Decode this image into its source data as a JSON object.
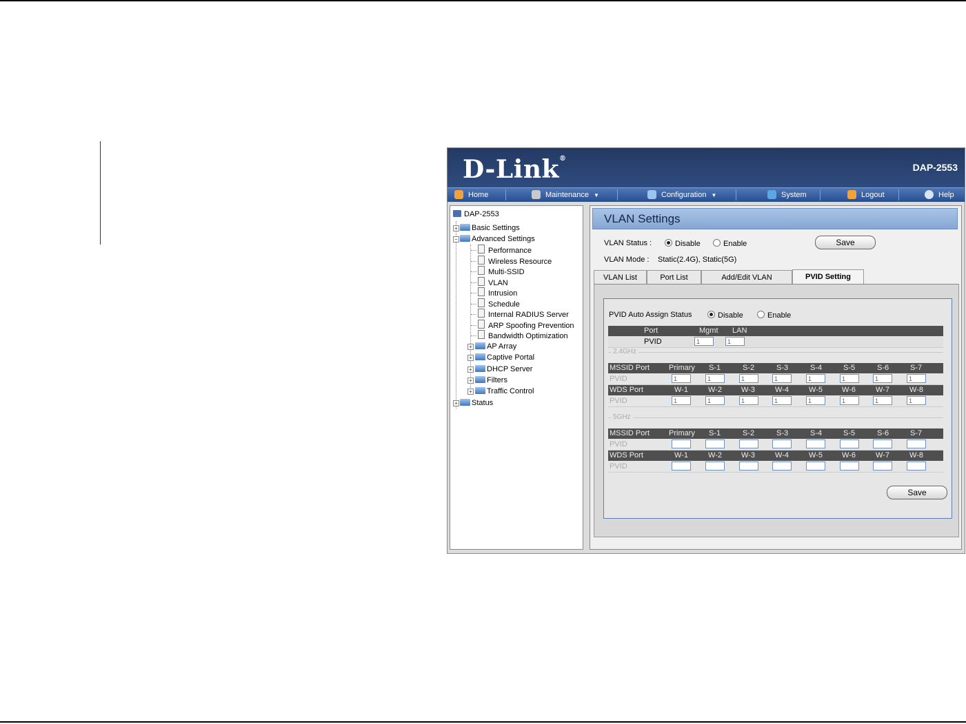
{
  "brand": {
    "logo": "D-Link",
    "model": "DAP-2553"
  },
  "menu": [
    {
      "label": "Home",
      "dropdown": false
    },
    {
      "label": "Maintenance",
      "dropdown": true
    },
    {
      "label": "Configuration",
      "dropdown": true
    },
    {
      "label": "System",
      "dropdown": false
    },
    {
      "label": "Logout",
      "dropdown": false
    },
    {
      "label": "Help",
      "dropdown": false
    }
  ],
  "tree": {
    "root": "DAP-2553",
    "items": [
      {
        "label": "Basic Settings"
      },
      {
        "label": "Advanced Settings"
      },
      {
        "label": "Performance"
      },
      {
        "label": "Wireless Resource"
      },
      {
        "label": "Multi-SSID"
      },
      {
        "label": "VLAN"
      },
      {
        "label": "Intrusion"
      },
      {
        "label": "Schedule"
      },
      {
        "label": "Internal RADIUS Server"
      },
      {
        "label": "ARP Spoofing Prevention"
      },
      {
        "label": "Bandwidth Optimization"
      },
      {
        "label": "AP Array"
      },
      {
        "label": "Captive Portal"
      },
      {
        "label": "DHCP Server"
      },
      {
        "label": "Filters"
      },
      {
        "label": "Traffic Control"
      },
      {
        "label": "Status"
      }
    ]
  },
  "page": {
    "title": "VLAN Settings",
    "vlan_status_label": "VLAN Status :",
    "disable": "Disable",
    "enable": "Enable",
    "save": "Save",
    "vlan_mode_label": "VLAN Mode :",
    "vlan_mode_value": "Static(2.4G),  Static(5G)",
    "tabs": [
      "VLAN List",
      "Port List",
      "Add/Edit VLAN",
      "PVID Setting"
    ],
    "active_tab": "PVID Setting",
    "pvid_auto_label": "PVID Auto Assign Status",
    "port_label": "Port",
    "pvid_label": "PVID",
    "mgmt": "Mgmt",
    "lan": "LAN",
    "mgmt_value": "1",
    "lan_value": "1",
    "band_24": "2.4GHz",
    "band_5": "5GHz",
    "mssid_port": "MSSID Port",
    "wds_port": "WDS Port",
    "mssid_cols": [
      "Primary",
      "S-1",
      "S-2",
      "S-3",
      "S-4",
      "S-5",
      "S-6",
      "S-7"
    ],
    "wds_cols": [
      "W-1",
      "W-2",
      "W-3",
      "W-4",
      "W-5",
      "W-6",
      "W-7",
      "W-8"
    ],
    "mssid_24_values": [
      "1",
      "1",
      "1",
      "1",
      "1",
      "1",
      "1",
      "1"
    ],
    "wds_24_values": [
      "1",
      "1",
      "1",
      "1",
      "1",
      "1",
      "1",
      "1"
    ],
    "mssid_5_values": [
      "",
      "",
      "",
      "",
      "",
      "",
      "",
      ""
    ],
    "wds_5_values": [
      "",
      "",
      "",
      "",
      "",
      "",
      "",
      ""
    ]
  }
}
